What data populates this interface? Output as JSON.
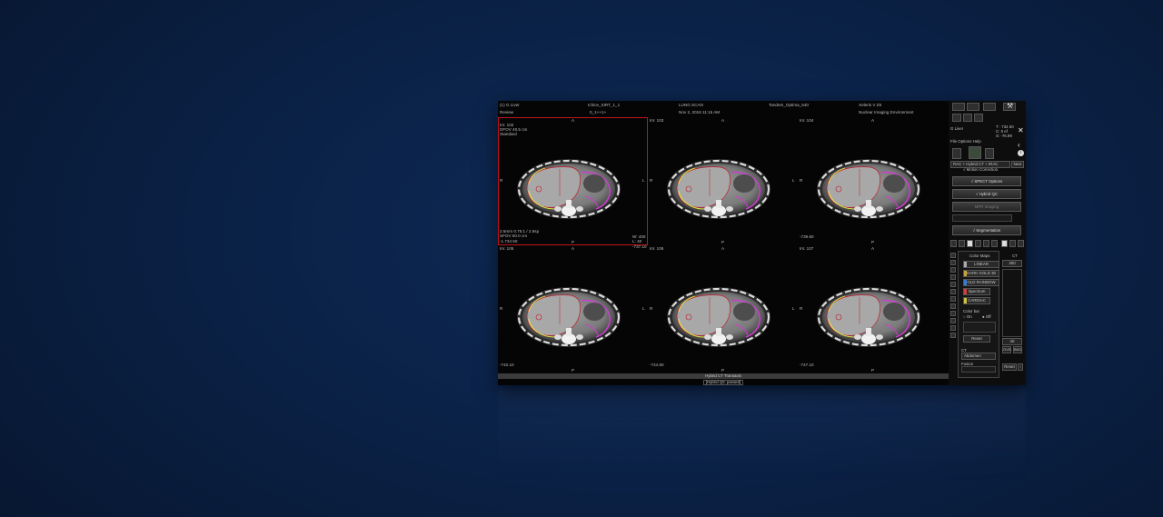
{
  "header": {
    "patient": "(1) G Liver",
    "series_id": "Ichiov_SIRT_1_1",
    "series_sub": "0_1++1+",
    "protocol": "LUNG SCAN",
    "date": "Nov 2, 2016 11:15 AM",
    "scanner": "Tandem_Optima_640",
    "software": "Xeleris V Z8",
    "environment": "Nuclear Imaging Environment",
    "mode": "Review"
  },
  "cells": [
    {
      "im": "Im: 102",
      "info": "DFOV 40.5 cm\nStandard",
      "orient_top": "A",
      "orient_left": "R",
      "orient_right": "L",
      "orient_bottom": "P",
      "footer_left": "2.5mm 0.75:1 / 2.5sp\nSFOV 50.0 cm\n-1.734 60",
      "footer_right": "W: 400\nL: 40 -737.10",
      "selected": true
    },
    {
      "im": "Im: 103",
      "info": "",
      "orient_top": "A",
      "orient_left": "R",
      "orient_right": "L",
      "orient_bottom": "P",
      "footer_left": "",
      "footer_right": "",
      "selected": false
    },
    {
      "im": "Im: 104",
      "info": "",
      "orient_top": "A",
      "orient_left": "R",
      "orient_right": "",
      "orient_bottom": "P",
      "footer_left": "-739.60",
      "footer_right": "",
      "selected": false
    },
    {
      "im": "Im: 105",
      "info": "",
      "orient_top": "A",
      "orient_left": "R",
      "orient_right": "L",
      "orient_bottom": "P",
      "footer_left": "-742.10",
      "footer_right": "",
      "selected": false
    },
    {
      "im": "Im: 106",
      "info": "",
      "orient_top": "A",
      "orient_left": "R",
      "orient_right": "L",
      "orient_bottom": "P",
      "footer_left": "-744.60",
      "footer_right": "",
      "selected": false
    },
    {
      "im": "Im: 107",
      "info": "",
      "orient_top": "A",
      "orient_left": "R",
      "orient_right": "",
      "orient_bottom": "P",
      "footer_left": "-747.10",
      "footer_right": "",
      "selected": false
    }
  ],
  "status": {
    "view_label": "Hybrid CT Transaxis",
    "qc_label": "[Hybrid QC passed]"
  },
  "sidebar": {
    "values": [
      "T : 734 60",
      "C: 0 ef",
      "S: -76.99"
    ],
    "study_label": "G Liver",
    "menu": "File  Options  Help",
    "protocol_select": "RAC + Hybrid CT + IRAC",
    "next_label": "Next",
    "motion_label": "√ Motion Correction",
    "spect_options": "√ SPECT Options",
    "hybrid_qc": "√ Hybrid QC",
    "mpr_imaging": "MPR Imaging",
    "segmentation": "√ Segmentation",
    "color_maps_title": "Color Maps",
    "color_maps": [
      "LINEAR",
      "DARK GOLD 30",
      "OLD RAINBOW",
      "Spectrum",
      "CARDIAC"
    ],
    "color_bar_label": "Color bar",
    "color_bar_on": "On",
    "color_bar_off": "Off",
    "reset_label": "Reset",
    "ct_label": "CT",
    "ct_preset": "Abdomen",
    "fusion_label": "Fusion",
    "window_top": "CT",
    "window_value": "400",
    "window_bottom": "40",
    "ovd_label": "OVD",
    "bkd_label": "BKD",
    "reset2_label": "Reset"
  },
  "colors": {
    "liver_contour": "#c01a2a",
    "tumor_contour": "#d23bd6",
    "rim_contour": "#e6e63a",
    "selection_border": "#c0141a",
    "background": "#0b2248"
  }
}
